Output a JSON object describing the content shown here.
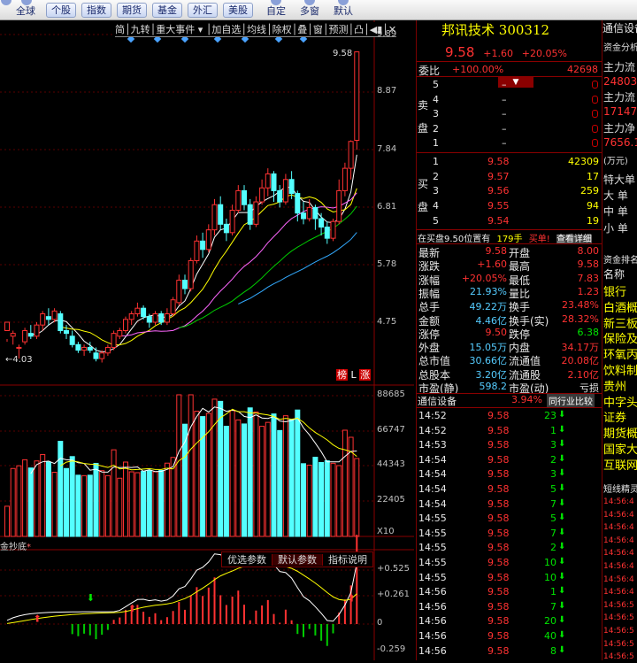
{
  "toolbar": {
    "left_items": [
      "全球"
    ],
    "buttons": [
      "个股",
      "指数",
      "期货",
      "基金",
      "外汇",
      "美股"
    ],
    "right_items": [
      "自定",
      "多窗",
      "默认"
    ]
  },
  "chart_toolbar": [
    "简",
    "九转",
    "重大事件",
    "加自选",
    "均线",
    "除权",
    "叠",
    "窗",
    "预测"
  ],
  "price_axis": [
    "9.89",
    "8.87",
    "7.84",
    "6.81",
    "5.78",
    "4.75"
  ],
  "high_label": "9.58",
  "low_label": "4.03",
  "badges": {
    "b1": "榜",
    "b2": "L",
    "b3": "涨"
  },
  "volume_axis": [
    "88685",
    "66747",
    "44343",
    "22405"
  ],
  "volume_unit": "X10",
  "indicator_name": "金抄底",
  "indicator_tabs": [
    "优选参数",
    "默认参数",
    "指标说明"
  ],
  "indicator_axis": [
    "+0.525",
    "+0.261",
    "0",
    "-0.259"
  ],
  "quote": {
    "name": "邦讯技术",
    "code": "300312",
    "price": "9.58",
    "change": "+1.60",
    "pct": "+20.05%",
    "weibi_label": "委比",
    "weibi_value": "+100.00%",
    "weicha": "42698",
    "sell_label": [
      "卖",
      "盘"
    ],
    "buy_label": [
      "买",
      "盘"
    ],
    "sell": [
      {
        "n": "5",
        "p": "–",
        "v": ""
      },
      {
        "n": "4",
        "p": "–",
        "v": ""
      },
      {
        "n": "3",
        "p": "–",
        "v": ""
      },
      {
        "n": "2",
        "p": "–",
        "v": ""
      },
      {
        "n": "1",
        "p": "–",
        "v": ""
      }
    ],
    "buy": [
      {
        "n": "1",
        "p": "9.58",
        "v": "42309"
      },
      {
        "n": "2",
        "p": "9.57",
        "v": "17"
      },
      {
        "n": "3",
        "p": "9.56",
        "v": "259"
      },
      {
        "n": "4",
        "p": "9.55",
        "v": "94"
      },
      {
        "n": "5",
        "p": "9.54",
        "v": "19"
      }
    ],
    "notice": {
      "a": "在买盘9.50位置有",
      "b": "179手",
      "c": "买单!",
      "d": "查看详细"
    },
    "stats": [
      [
        "最新",
        "9.58",
        "开盘",
        "8.00"
      ],
      [
        "涨跌",
        "+1.60",
        "最高",
        "9.58"
      ],
      [
        "涨幅",
        "+20.05%",
        "最低",
        "7.83"
      ],
      [
        "振幅",
        "21.93%",
        "量比",
        "1.23"
      ],
      [
        "总手",
        "49.22万",
        "换手",
        "23.48%"
      ],
      [
        "金额",
        "4.46亿",
        "换手(实)",
        "28.32%"
      ],
      [
        "涨停",
        "9.50",
        "跌停",
        "6.38"
      ],
      [
        "外盘",
        "15.05万",
        "内盘",
        "34.17万"
      ],
      [
        "总市值",
        "30.66亿",
        "流通值",
        "20.08亿"
      ],
      [
        "总股本",
        "3.20亿",
        "流通股",
        "2.10亿"
      ],
      [
        "市盈(静)",
        "598.2",
        "市盈(动)",
        "亏损"
      ]
    ],
    "sector": {
      "name": "通信设备",
      "pct": "3.94%",
      "btn": "同行业比较"
    },
    "ticks": [
      [
        "14:52",
        "9.58",
        "23"
      ],
      [
        "14:52",
        "9.58",
        "1"
      ],
      [
        "14:53",
        "9.58",
        "3"
      ],
      [
        "14:54",
        "9.58",
        "2"
      ],
      [
        "14:54",
        "9.58",
        "3"
      ],
      [
        "14:54",
        "9.58",
        "5"
      ],
      [
        "14:54",
        "9.58",
        "7"
      ],
      [
        "14:55",
        "9.58",
        "5"
      ],
      [
        "14:55",
        "9.58",
        "7"
      ],
      [
        "14:55",
        "9.58",
        "2"
      ],
      [
        "14:55",
        "9.58",
        "10"
      ],
      [
        "14:55",
        "9.58",
        "10"
      ],
      [
        "14:56",
        "9.58",
        "1"
      ],
      [
        "14:56",
        "9.58",
        "7"
      ],
      [
        "14:56",
        "9.58",
        "20"
      ],
      [
        "14:56",
        "9.58",
        "40"
      ],
      [
        "14:56",
        "9.58",
        "8"
      ]
    ]
  },
  "far": {
    "header": "通信设备",
    "labels": [
      "资金分析",
      "主力流",
      "24803",
      "主力流",
      "17147",
      "主力净",
      "7656.1",
      "(万元)",
      "特大单",
      "大 单",
      "中 单",
      "小 单"
    ],
    "rank_header": "资金排名",
    "rank_sub": "名称",
    "rank": [
      "银行",
      "白酒概",
      "新三板",
      "保险及",
      "环氧丙",
      "饮料制",
      "贵州",
      "中字头",
      "证券",
      "期货概",
      "国家大",
      "互联网"
    ],
    "news_title": "短线精灵",
    "news": [
      "14:56:4",
      "14:56:4",
      "14:56:4",
      "14:56:4",
      "14:56:4",
      "14:56:4",
      "14:56:4",
      "14:56:4",
      "14:56:5",
      "14:56:5",
      "14:56:5",
      "14:56:5",
      "14:56:5"
    ]
  },
  "colors": {
    "up": "#ff3232",
    "down": "#54ffff",
    "ma5": "#ffffff",
    "ma10": "#ffff00",
    "ma20": "#ff66ff",
    "ma30": "#00cc00",
    "ma60": "#33aaff"
  },
  "chart_data": {
    "type": "candlestick",
    "note": "daily k-line with volume and oscillator panels",
    "ohlc": [
      [
        4.6,
        4.75,
        4.45,
        4.4
      ],
      [
        4.5,
        4.55,
        4.6,
        4.35
      ],
      [
        4.3,
        4.3,
        4.35,
        4.1
      ],
      [
        4.4,
        4.6,
        4.65,
        4.35
      ],
      [
        4.55,
        4.5,
        4.7,
        4.45
      ],
      [
        4.5,
        4.7,
        4.75,
        4.45
      ],
      [
        4.7,
        4.9,
        4.95,
        4.6
      ],
      [
        4.85,
        4.8,
        5.0,
        4.7
      ],
      [
        4.8,
        4.95,
        5.0,
        4.75
      ],
      [
        4.9,
        4.6,
        4.95,
        4.55
      ],
      [
        4.6,
        4.55,
        4.7,
        4.45
      ],
      [
        4.5,
        4.35,
        4.6,
        4.3
      ],
      [
        4.35,
        4.25,
        4.4,
        4.2
      ],
      [
        4.25,
        4.3,
        4.35,
        4.15
      ],
      [
        4.3,
        4.25,
        4.4,
        4.2
      ],
      [
        4.2,
        4.1,
        4.3,
        4.05
      ],
      [
        4.1,
        4.2,
        4.25,
        4.03
      ],
      [
        4.2,
        4.3,
        4.35,
        4.15
      ],
      [
        4.3,
        4.55,
        4.6,
        4.25
      ],
      [
        4.5,
        4.6,
        4.65,
        4.45
      ],
      [
        4.6,
        4.8,
        4.85,
        4.55
      ],
      [
        4.8,
        4.9,
        4.95,
        4.7
      ],
      [
        4.9,
        5.0,
        5.1,
        4.85
      ],
      [
        5.0,
        4.85,
        5.05,
        4.8
      ],
      [
        4.85,
        4.75,
        4.9,
        4.65
      ],
      [
        4.75,
        4.9,
        4.95,
        4.7
      ],
      [
        4.9,
        4.75,
        4.95,
        4.7
      ],
      [
        4.75,
        4.9,
        5.0,
        4.7
      ],
      [
        4.9,
        5.15,
        5.2,
        4.85
      ],
      [
        5.1,
        5.5,
        5.6,
        5.05
      ],
      [
        5.5,
        5.35,
        5.6,
        5.25
      ],
      [
        5.35,
        5.85,
        5.9,
        5.3
      ],
      [
        5.85,
        6.2,
        6.3,
        5.8
      ],
      [
        6.2,
        6.05,
        6.35,
        5.9
      ],
      [
        6.05,
        6.4,
        6.5,
        6.0
      ],
      [
        6.4,
        6.85,
        6.95,
        6.3
      ],
      [
        6.85,
        6.5,
        7.0,
        6.4
      ],
      [
        6.5,
        6.35,
        6.6,
        6.2
      ],
      [
        6.35,
        6.75,
        6.85,
        6.3
      ],
      [
        6.75,
        7.1,
        7.2,
        6.7
      ],
      [
        7.1,
        6.85,
        7.2,
        6.75
      ],
      [
        6.85,
        6.5,
        6.95,
        6.4
      ],
      [
        6.5,
        6.9,
        7.0,
        6.45
      ],
      [
        6.9,
        7.15,
        7.3,
        6.85
      ],
      [
        7.15,
        7.4,
        7.5,
        7.0
      ],
      [
        7.4,
        7.1,
        7.45,
        6.9
      ],
      [
        7.1,
        6.9,
        7.2,
        6.8
      ],
      [
        6.9,
        7.3,
        7.4,
        6.85
      ],
      [
        7.3,
        7.05,
        7.45,
        6.95
      ],
      [
        7.05,
        6.7,
        7.1,
        6.55
      ],
      [
        6.7,
        6.6,
        6.9,
        6.5
      ],
      [
        6.6,
        6.8,
        6.95,
        6.55
      ],
      [
        6.8,
        6.6,
        6.85,
        6.4
      ],
      [
        6.6,
        6.45,
        6.7,
        6.3
      ],
      [
        6.45,
        6.25,
        6.55,
        6.15
      ],
      [
        6.25,
        6.55,
        6.6,
        6.2
      ],
      [
        6.55,
        7.1,
        7.3,
        6.5
      ],
      [
        7.1,
        7.5,
        7.6,
        7.0
      ],
      [
        7.5,
        7.98,
        8.0,
        7.3
      ],
      [
        8.0,
        9.58,
        9.58,
        7.83
      ]
    ],
    "volume_max": 88685
  }
}
